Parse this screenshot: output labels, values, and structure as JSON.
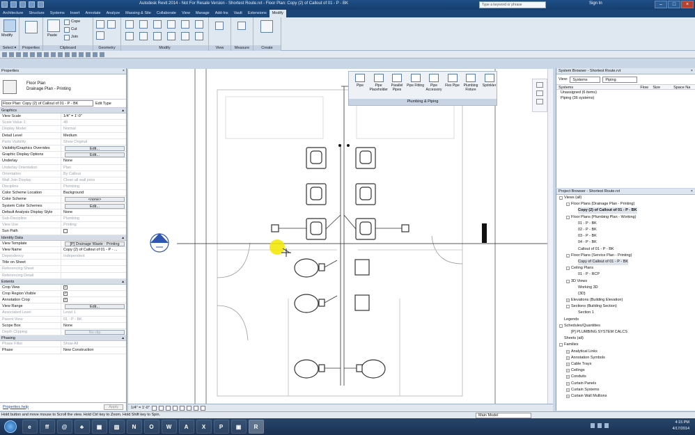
{
  "window": {
    "title": "Autodesk Revit 2014 - Not For Resale Version -   Shortest Route.rvt - Floor Plan: Copy (2) of Callout of 01 - P - BK",
    "search_placeholder": "Type a keyword or phrase",
    "sign_in": "Sign In"
  },
  "tabs": [
    "Architecture",
    "Structure",
    "Systems",
    "Insert",
    "Annotate",
    "Analyze",
    "Massing & Site",
    "Collaborate",
    "View",
    "Manage",
    "Add-Ins",
    "Vault",
    "Extensions",
    "Modify"
  ],
  "active_tab": "Modify",
  "ribbon": {
    "panels": [
      "Select",
      "Properties",
      "Clipboard",
      "Geometry",
      "Modify",
      "View",
      "Measure",
      "Create"
    ],
    "modify_label": "Modify",
    "select_label": "Select ▾",
    "paste_label": "Paste",
    "cope_label": "Cope",
    "cut_label": "Cut",
    "join_label": "Join"
  },
  "properties": {
    "title": "Properties",
    "type_line1": "Floor Plan",
    "type_line2": "Drainage Plan - Printing",
    "instance_selector": "Floor Plan: Copy (2) of Callout of 01 - P - BK",
    "edit_type": "Edit Type",
    "groups": [
      {
        "name": "Graphics",
        "rows": [
          {
            "k": "View Scale",
            "v": "1/4\" = 1'-0\"",
            "dim": false
          },
          {
            "k": "Scale Value    1:",
            "v": "48",
            "dim": true
          },
          {
            "k": "Display Model",
            "v": "Normal",
            "dim": true
          },
          {
            "k": "Detail Level",
            "v": "Medium",
            "dim": false
          },
          {
            "k": "Parts Visibility",
            "v": "Show Original",
            "dim": true
          },
          {
            "k": "Visibility/Graphics Overrides",
            "v": "Edit...",
            "dim": false,
            "btn": true
          },
          {
            "k": "Graphic Display Options",
            "v": "Edit...",
            "dim": false,
            "btn": true
          },
          {
            "k": "Underlay",
            "v": "None",
            "dim": false
          },
          {
            "k": "Underlay Orientation",
            "v": "Plan",
            "dim": true
          },
          {
            "k": "Orientation",
            "v": "By Callout",
            "dim": true
          },
          {
            "k": "Wall Join Display",
            "v": "Clean all wall joins",
            "dim": true
          },
          {
            "k": "Discipline",
            "v": "Plumbing",
            "dim": true
          },
          {
            "k": "Color Scheme Location",
            "v": "Background",
            "dim": false
          },
          {
            "k": "Color Scheme",
            "v": "<none>",
            "dim": false,
            "btn": true
          },
          {
            "k": "System Color Schemes",
            "v": "Edit...",
            "dim": false,
            "btn": true
          },
          {
            "k": "Default Analysis Display Style",
            "v": "None",
            "dim": false
          },
          {
            "k": "Sub-Discipline",
            "v": "Plumbing",
            "dim": true
          },
          {
            "k": "View Use",
            "v": "Printing",
            "dim": true
          },
          {
            "k": "Sun Path",
            "v": "",
            "dim": false,
            "chk": false
          }
        ]
      },
      {
        "name": "Identity Data",
        "rows": [
          {
            "k": "View Template",
            "v": "[P] Drainage Waste - Printing",
            "dim": false,
            "btn": true
          },
          {
            "k": "View Name",
            "v": "Copy (2) of Callout of 01 - P - ...",
            "dim": false
          },
          {
            "k": "Dependency",
            "v": "Independent",
            "dim": true
          },
          {
            "k": "Title on Sheet",
            "v": "",
            "dim": false
          },
          {
            "k": "Referencing Sheet",
            "v": "",
            "dim": true
          },
          {
            "k": "Referencing Detail",
            "v": "",
            "dim": true
          }
        ]
      },
      {
        "name": "Extents",
        "rows": [
          {
            "k": "Crop View",
            "v": "",
            "dim": false,
            "chk": true
          },
          {
            "k": "Crop Region Visible",
            "v": "",
            "dim": false,
            "chk": true
          },
          {
            "k": "Annotation Crop",
            "v": "",
            "dim": false,
            "chk": true
          },
          {
            "k": "View Range",
            "v": "Edit...",
            "dim": false,
            "btn": true
          },
          {
            "k": "Associated Level",
            "v": "Level 1",
            "dim": true
          },
          {
            "k": "Parent View",
            "v": "01 - P - BK",
            "dim": true
          },
          {
            "k": "Scope Box",
            "v": "None",
            "dim": false
          },
          {
            "k": "Depth Clipping",
            "v": "No clip",
            "dim": true,
            "btn": true
          }
        ]
      },
      {
        "name": "Phasing",
        "rows": [
          {
            "k": "Phase Filter",
            "v": "Show All",
            "dim": true
          },
          {
            "k": "Phase",
            "v": "New Construction",
            "dim": false
          }
        ]
      }
    ],
    "help": "Properties help",
    "apply": "Apply"
  },
  "plumbing_panel": {
    "items": [
      "Pipe",
      "Pipe Placeholder",
      "Parallel Pipes",
      "Pipe Fitting",
      "Pipe Accessory",
      "Flex Pipe",
      "Plumbing Fixture",
      "Sprinkler"
    ],
    "label": "Plumbing & Piping"
  },
  "view_control": {
    "scale": "1/4\" = 1'-0\""
  },
  "system_browser": {
    "title": "System Browser - Shortest Route.rvt",
    "view_label": "View:",
    "view_value": "Systems",
    "filter_value": "Piping",
    "columns": [
      "Systems",
      "Flow",
      "Size",
      "Space Na"
    ],
    "items": [
      "Unassigned (6 items)",
      "Piping (36 systems)"
    ]
  },
  "project_browser": {
    "title": "Project Browser - Shortest Route.rvt",
    "items": [
      {
        "t": "Views (all)",
        "d": 0,
        "e": "-"
      },
      {
        "t": "Floor Plans (Drainage Plan - Printing)",
        "d": 1,
        "e": "-"
      },
      {
        "t": "Copy (2) of Callout of 01 - P - BK",
        "d": 2,
        "e": "",
        "sel": true,
        "bold": true
      },
      {
        "t": "Floor Plans (Plumbing Plan - Working)",
        "d": 1,
        "e": "-"
      },
      {
        "t": "01 - P - BK",
        "d": 2,
        "e": ""
      },
      {
        "t": "02 - P - BK",
        "d": 2,
        "e": ""
      },
      {
        "t": "03 - P - BK",
        "d": 2,
        "e": ""
      },
      {
        "t": "04 - P - BK",
        "d": 2,
        "e": ""
      },
      {
        "t": "Callout of 01 - P - BK",
        "d": 2,
        "e": ""
      },
      {
        "t": "Floor Plans (Service Plan - Printing)",
        "d": 1,
        "e": "-"
      },
      {
        "t": "Copy of Callout of 01 - P - BK",
        "d": 2,
        "e": "",
        "sel": true
      },
      {
        "t": "Ceiling Plans",
        "d": 1,
        "e": "-"
      },
      {
        "t": "01 - P - RCP",
        "d": 2,
        "e": ""
      },
      {
        "t": "3D Views",
        "d": 1,
        "e": "-"
      },
      {
        "t": "Working 3D",
        "d": 2,
        "e": ""
      },
      {
        "t": "{3D}",
        "d": 2,
        "e": ""
      },
      {
        "t": "Elevations (Building Elevation)",
        "d": 1,
        "e": "+"
      },
      {
        "t": "Sections (Building Section)",
        "d": 1,
        "e": "-"
      },
      {
        "t": "Section 1",
        "d": 2,
        "e": ""
      },
      {
        "t": "Legends",
        "d": 0,
        "e": ""
      },
      {
        "t": "Schedules/Quantities",
        "d": 0,
        "e": "-"
      },
      {
        "t": "[P] PLUMBING SYSTEM CALCS",
        "d": 1,
        "e": ""
      },
      {
        "t": "Sheets (all)",
        "d": 0,
        "e": ""
      },
      {
        "t": "Families",
        "d": 0,
        "e": "-"
      },
      {
        "t": "Analytical Links",
        "d": 1,
        "e": "+"
      },
      {
        "t": "Annotation Symbols",
        "d": 1,
        "e": "+"
      },
      {
        "t": "Cable Trays",
        "d": 1,
        "e": "+"
      },
      {
        "t": "Ceilings",
        "d": 1,
        "e": "+"
      },
      {
        "t": "Conduits",
        "d": 1,
        "e": "+"
      },
      {
        "t": "Curtain Panels",
        "d": 1,
        "e": "+"
      },
      {
        "t": "Curtain Systems",
        "d": 1,
        "e": "+"
      },
      {
        "t": "Curtain Wall Mullions",
        "d": 1,
        "e": "+"
      }
    ]
  },
  "status": {
    "text": "Hold button and move mouse to Scroll the view. Hold Ctrl key to Zoom. Hold Shift key to Spin.",
    "model": "Main Model"
  },
  "taskbar": {
    "time": "4:15 PM",
    "date": "4/17/2014",
    "apps": [
      "e",
      "ff",
      "@",
      "♣",
      "▦",
      "▥",
      "N",
      "O",
      "W",
      "A",
      "X",
      "P",
      "▣",
      "R"
    ]
  },
  "accent": "#1b4576"
}
